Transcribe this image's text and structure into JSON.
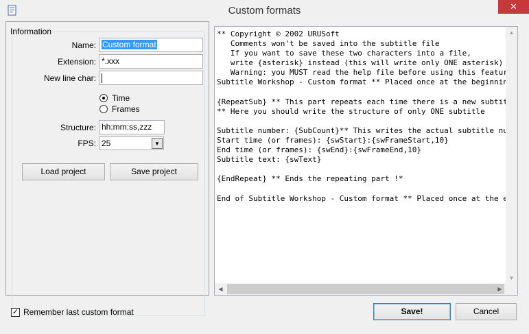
{
  "window": {
    "title": "Custom formats",
    "close_glyph": "✕",
    "app_icon": "document-app-icon"
  },
  "information": {
    "group_label": "Information",
    "name_label": "Name:",
    "name_value": "Custom format",
    "extension_label": "Extension:",
    "extension_value": "*.xxx",
    "newline_label": "New line char:",
    "newline_value": "",
    "time_option": "Time",
    "frames_option": "Frames",
    "selected_mode": "Time",
    "structure_label": "Structure:",
    "structure_value": "hh:mm:ss,zzz",
    "fps_label": "FPS:",
    "fps_value": "25",
    "load_project": "Load project",
    "save_project": "Save project"
  },
  "editor": {
    "text": "** Copyright © 2002 URUSoft\n   Comments won't be saved into the subtitle file\n   If you want to save these two characters into a file,\n   write {asterisk} instead (this will write only ONE asterisk)\n   Warning: you MUST read the help file before using this feature\nSubtitle Workshop - Custom format ** Placed once at the beginning\n\n{RepeatSub} ** This part repeats each time there is a new subtitle\n** Here you should write the structure of only ONE subtitle\n\nSubtitle number: {SubCount}** This writes the actual subtitle number\nStart time (or frames): {swStart}:{swFrameStart,10}\nEnd time (or frames): {swEnd}:{swFrameEnd,10}\nSubtitle text: {swText}\n\n{EndRepeat} ** Ends the repeating part !*\n\nEnd of Subtitle Workshop - Custom format ** Placed once at the end"
  },
  "footer": {
    "remember_label": "Remember last custom format",
    "remember_checked": true,
    "save_button": "Save!",
    "cancel_button": "Cancel"
  }
}
